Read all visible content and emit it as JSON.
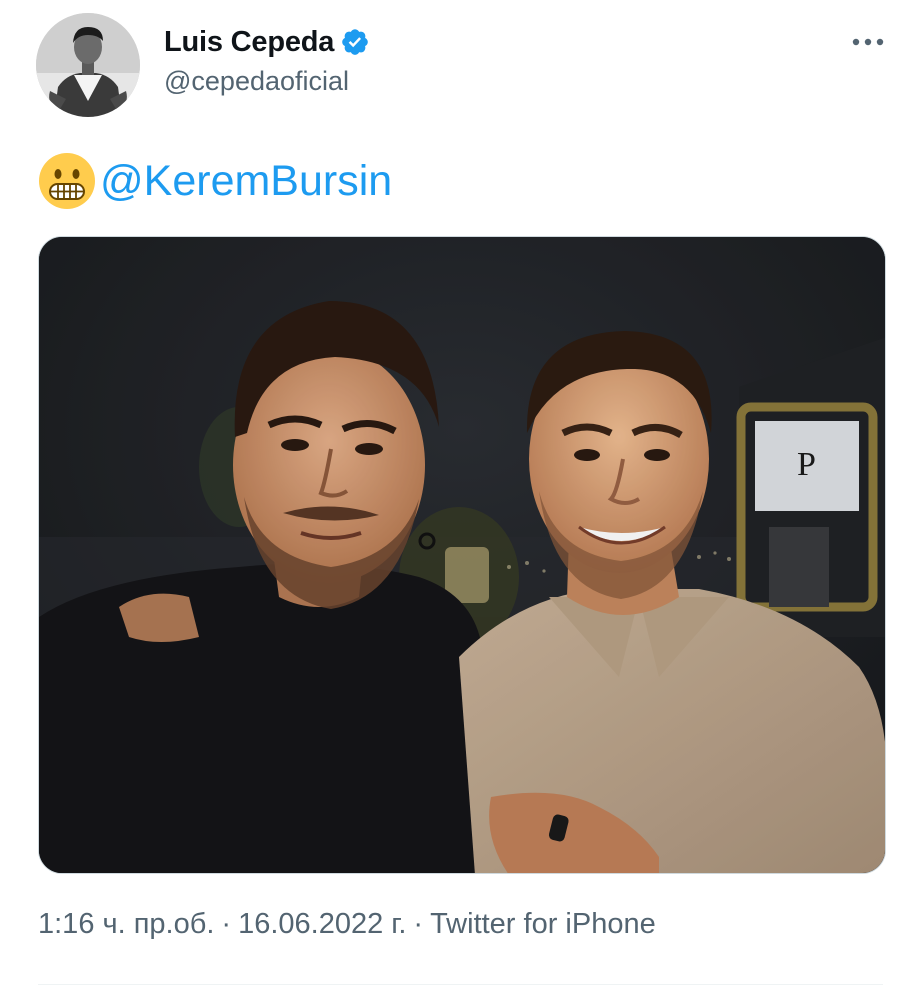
{
  "author": {
    "display_name": "Luis Cepeda",
    "handle": "@cepedaoficial",
    "verified": true,
    "avatar": "avatar-photo"
  },
  "tweet": {
    "emoji": "grimacing-face-emoji",
    "mention": "@KeremBursin",
    "photo": "selfie-two-men-rooftop-night"
  },
  "meta": {
    "time": "1:16 ч. пр.об.",
    "separator": "·",
    "date": "16.06.2022 г.",
    "source": "Twitter for iPhone"
  },
  "icons": {
    "more": "more-horizontal-icon",
    "verified": "verified-badge-icon"
  },
  "colors": {
    "link": "#1d9bf0",
    "secondary_text": "#536471",
    "primary_text": "#0f1419",
    "verified": "#1d9bf0"
  }
}
